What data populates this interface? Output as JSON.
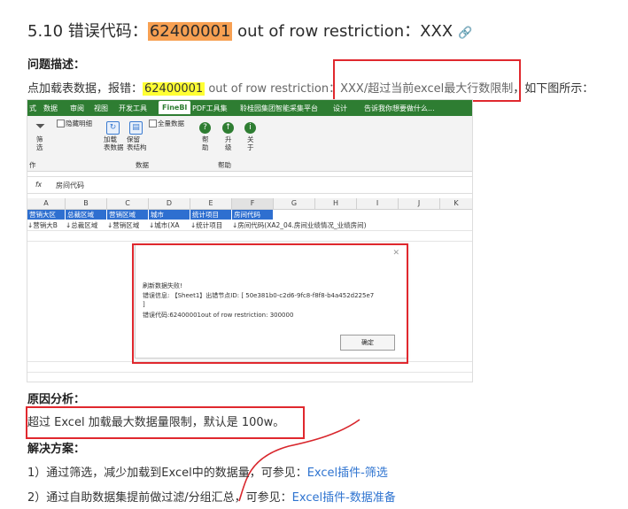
{
  "heading": {
    "prefix": "5.10 错误代码：",
    "code": "62400001",
    "suffix": " out of row restriction：XXX",
    "link_icon": "link-icon"
  },
  "problem": {
    "title": "问题描述：",
    "text_before": "点加载表数据，报错：",
    "code": "62400001",
    "text_gray": " out of row restriction：",
    "text_boxed": "XXX/超过当前excel最大行数限制",
    "text_after": "，如下图所示："
  },
  "screenshot": {
    "tabs": [
      "式",
      "数据",
      "审阅",
      "视图",
      "开发工具",
      "FineBI",
      "PDF工具集",
      "聆桂园集团智能采集平台",
      "设计",
      "告诉我你想要做什么..."
    ],
    "active_tab": "FineBI",
    "ribbon": {
      "filter_label": "筛\n选",
      "filter_group": "作",
      "hide_details": "隐藏明细",
      "full_data": "全量数据",
      "load_label": "加载\n表数据",
      "keep_label": "保留\n表结构",
      "data_group": "数据",
      "help_label": "帮\n助",
      "upgrade_label": "升\n级",
      "about_label": "关\n于",
      "help_group": "帮助"
    },
    "formula_bar": {
      "fx": "fx",
      "value": "房间代码"
    },
    "columns": [
      "A",
      "B",
      "C",
      "D",
      "E",
      "F",
      "G",
      "H",
      "I",
      "J",
      "K"
    ],
    "header_row": [
      "营销大区",
      "总裁区域",
      "营销区域",
      "城市",
      "统计项目",
      "房间代码"
    ],
    "second_row": [
      "↓营销大B",
      "↓总裁区域",
      "↓营销区域",
      "↓城市(XA",
      "↓统计项目",
      "↓房间代码(XA2_04.房间业绩情况_业绩房间)"
    ],
    "dialog": {
      "line1": "刷新数据失败!",
      "line2": "错误信息: 【Sheet1】出错节点ID: [ 50e381b0-c2d6-9fc8-f8f8-b4a452d225e7",
      "line3": "]",
      "line4": "错误代码:62400001out of row restriction: 300000",
      "ok": "确定"
    }
  },
  "cause": {
    "title": "原因分析：",
    "text": "超过 Excel 加载最大数据量限制，默认是 100w。"
  },
  "solution": {
    "title": "解决方案：",
    "item1_text": "1）通过筛选，减少加载到Excel中的数据量，可参见：",
    "item1_link": "Excel插件-筛选",
    "item2_text": "2）通过自助数据集提前做过滤/分组汇总，可参见：",
    "item2_link": "Excel插件-数据准备"
  },
  "colors": {
    "highlight_orange": "#f7a052",
    "highlight_yellow": "#ffff33",
    "red_box": "#e0282e",
    "link": "#2f74d0",
    "excel_green": "#2e7d32"
  }
}
